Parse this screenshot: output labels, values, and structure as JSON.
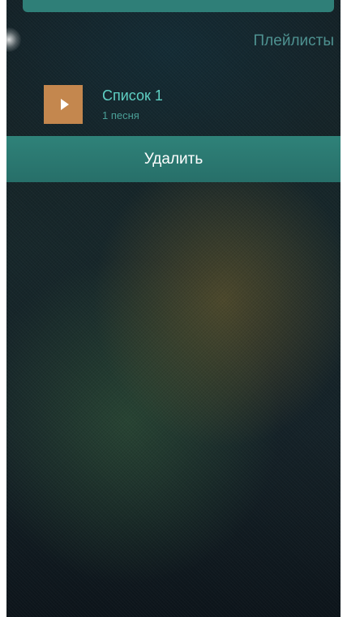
{
  "header": {
    "section_title": "Плейлисты"
  },
  "playlist": {
    "items": [
      {
        "title": "Список 1",
        "subtitle": "1 песня",
        "icon": "play-icon",
        "thumb_color": "#c4874e"
      }
    ]
  },
  "actions": {
    "delete_label": "Удалить"
  },
  "colors": {
    "accent": "#2f8279",
    "title_text": "#5fd0c4",
    "section_text": "#4e9190"
  }
}
